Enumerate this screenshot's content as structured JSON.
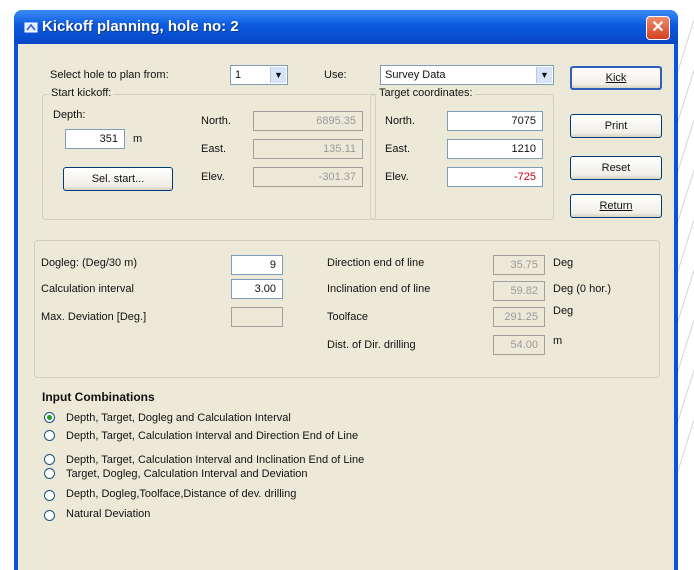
{
  "window": {
    "title": "Kickoff planning, hole no: 2",
    "close_label": "✕"
  },
  "top": {
    "select_hole_label": "Select hole to plan from:",
    "hole_value": "1",
    "use_label": "Use:",
    "use_value": "Survey Data"
  },
  "start_kickoff": {
    "title": "Start kickoff:",
    "depth_label": "Depth:",
    "depth_value": "351",
    "depth_unit": "m",
    "sel_start_label": "Sel. start...",
    "north_label": "North.",
    "north_value": "6895.35",
    "east_label": "East.",
    "east_value": "135.11",
    "elev_label": "Elev.",
    "elev_value": "-301.37"
  },
  "target": {
    "title": "Target coordinates:",
    "north_label": "North.",
    "north_value": "7075",
    "east_label": "East.",
    "east_value": "1210",
    "elev_label": "Elev.",
    "elev_value": "-725"
  },
  "buttons": {
    "kick": "Kick",
    "print": "Print",
    "reset": "Reset",
    "return": "Return"
  },
  "params": {
    "dogleg_label": "Dogleg: (Deg/30 m)",
    "dogleg_value": "9",
    "calc_interval_label": "Calculation interval",
    "calc_interval_value": "3.00",
    "max_dev_label": "Max. Deviation [Deg.]",
    "max_dev_value": "",
    "dir_end_label": "Direction end of line",
    "dir_end_value": "35.75",
    "dir_end_unit": "Deg",
    "incl_end_label": "Inclination end of line",
    "incl_end_value": "59.82",
    "incl_end_unit": "Deg (0 hor.)",
    "toolface_label": "Toolface",
    "toolface_value": "291.25",
    "toolface_unit": "Deg",
    "dist_label": "Dist. of Dir. drilling",
    "dist_value": "54.00",
    "dist_unit": "m"
  },
  "input_combinations": {
    "title": "Input Combinations",
    "options": [
      "Depth, Target, Dogleg and Calculation Interval",
      "Depth, Target, Calculation Interval and Direction End of Line",
      "Depth, Target, Calculation Interval and Inclination End of Line",
      "Target, Dogleg, Calculation Interval and Deviation",
      "Depth, Dogleg,Toolface,Distance of dev. drilling",
      "Natural Deviation"
    ],
    "selected": 0
  }
}
